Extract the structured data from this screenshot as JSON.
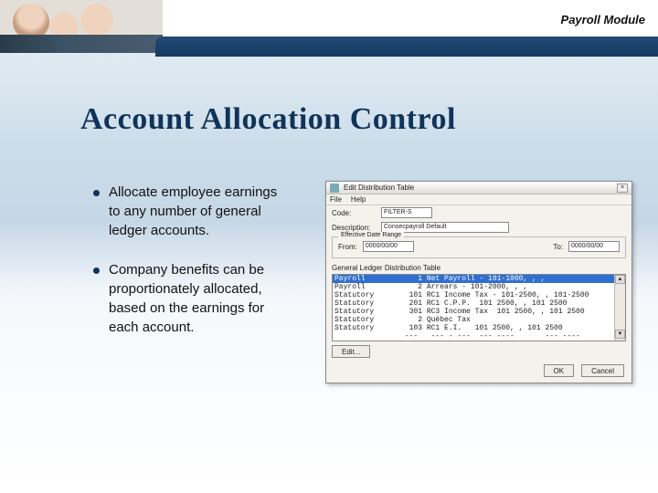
{
  "header": {
    "module_label": "Payroll Module"
  },
  "title": "Account Allocation Control",
  "bullets": [
    "Allocate employee earnings to any number of general ledger accounts.",
    "Company benefits can be proportionately allocated, based on the earnings for each account."
  ],
  "dialog": {
    "window_title": "Edit Distribution Table",
    "close_label": "×",
    "menu": [
      "File",
      "Help"
    ],
    "code_label": "Code:",
    "code_value": "FILTER-S",
    "description_label": "Description:",
    "description_value": "Consecpayroll Default",
    "date_range_legend": "Effective Date Range",
    "from_label": "From:",
    "from_value": "0000/00/00",
    "to_label": "To:",
    "to_value": "0000/00/00",
    "gl_table_title": "General Ledger Distribution Table",
    "list_rows": [
      {
        "text": "Payroll            1 Net Payroll - 101-1000, , ,",
        "selected": true
      },
      {
        "text": "Payroll            2 Arrears - 101-2000, , ,",
        "selected": false
      },
      {
        "text": "Statutory        101 RC1 Income Tax - 101-2500, , 101-2500",
        "selected": false
      },
      {
        "text": "Statutory        201 RC1 C.P.P.  101 2500, , 101 2500",
        "selected": false
      },
      {
        "text": "Statutory        301 RC3 Income Tax  101 2500, , 101 2500",
        "selected": false
      },
      {
        "text": "Statutory          2 Québec Tax",
        "selected": false
      },
      {
        "text": "Statutory        103 RC1 E.I.   101 2500, , 101 2500",
        "selected": false
      },
      {
        "text": "                ---   --- - ---  --- ----       --- ----",
        "selected": false
      }
    ],
    "edit_button": "Edit...",
    "ok_button": "OK",
    "cancel_button": "Cancel"
  }
}
